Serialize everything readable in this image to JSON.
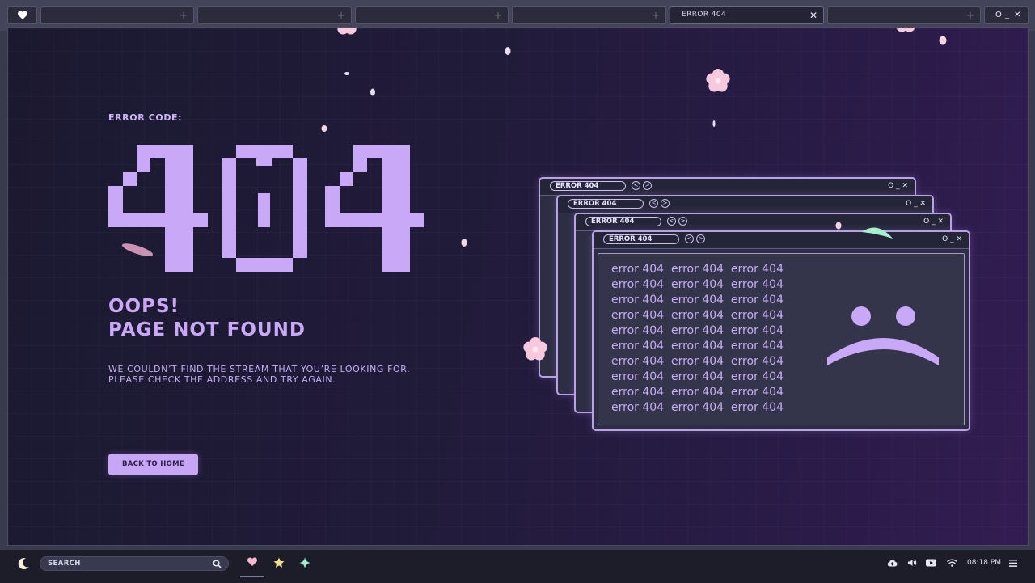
{
  "tabs": {
    "active_label": "ERROR 404",
    "close_glyph": "✕",
    "new_tab_glyph": "+",
    "window_controls": [
      "O",
      "_",
      "✕"
    ]
  },
  "main": {
    "error_code_label": "ERROR CODE:",
    "big_code": "404",
    "headline_line1": "OOPS!",
    "headline_line2": "PAGE NOT FOUND",
    "message_line1": "WE COULDN’T FIND THE STREAM THAT YOU’RE LOOKING FOR.",
    "message_line2": "PLEASE CHECK THE ADDRESS AND TRY AGAIN.",
    "back_button": "BACK TO HOME"
  },
  "error_windows": {
    "title": "ERROR 404",
    "nav_back": "<",
    "nav_forward": ">",
    "controls": "O _ ✕",
    "repeated_text": "error 404  error 404  error 404",
    "line_count": 10
  },
  "taskbar": {
    "search_label": "SEARCH",
    "time": "08:18 PM",
    "icons": [
      "moon-icon",
      "search-icon",
      "heart-icon",
      "star-icon",
      "sparkle-icon",
      "cloud-upload-icon",
      "volume-icon",
      "youtube-icon",
      "wifi-icon",
      "menu-icon"
    ]
  },
  "colors": {
    "accent": "#c7a6f6",
    "background": "#211b3a",
    "frame": "#3a3a4e",
    "taskbar": "#1d1d2a"
  }
}
